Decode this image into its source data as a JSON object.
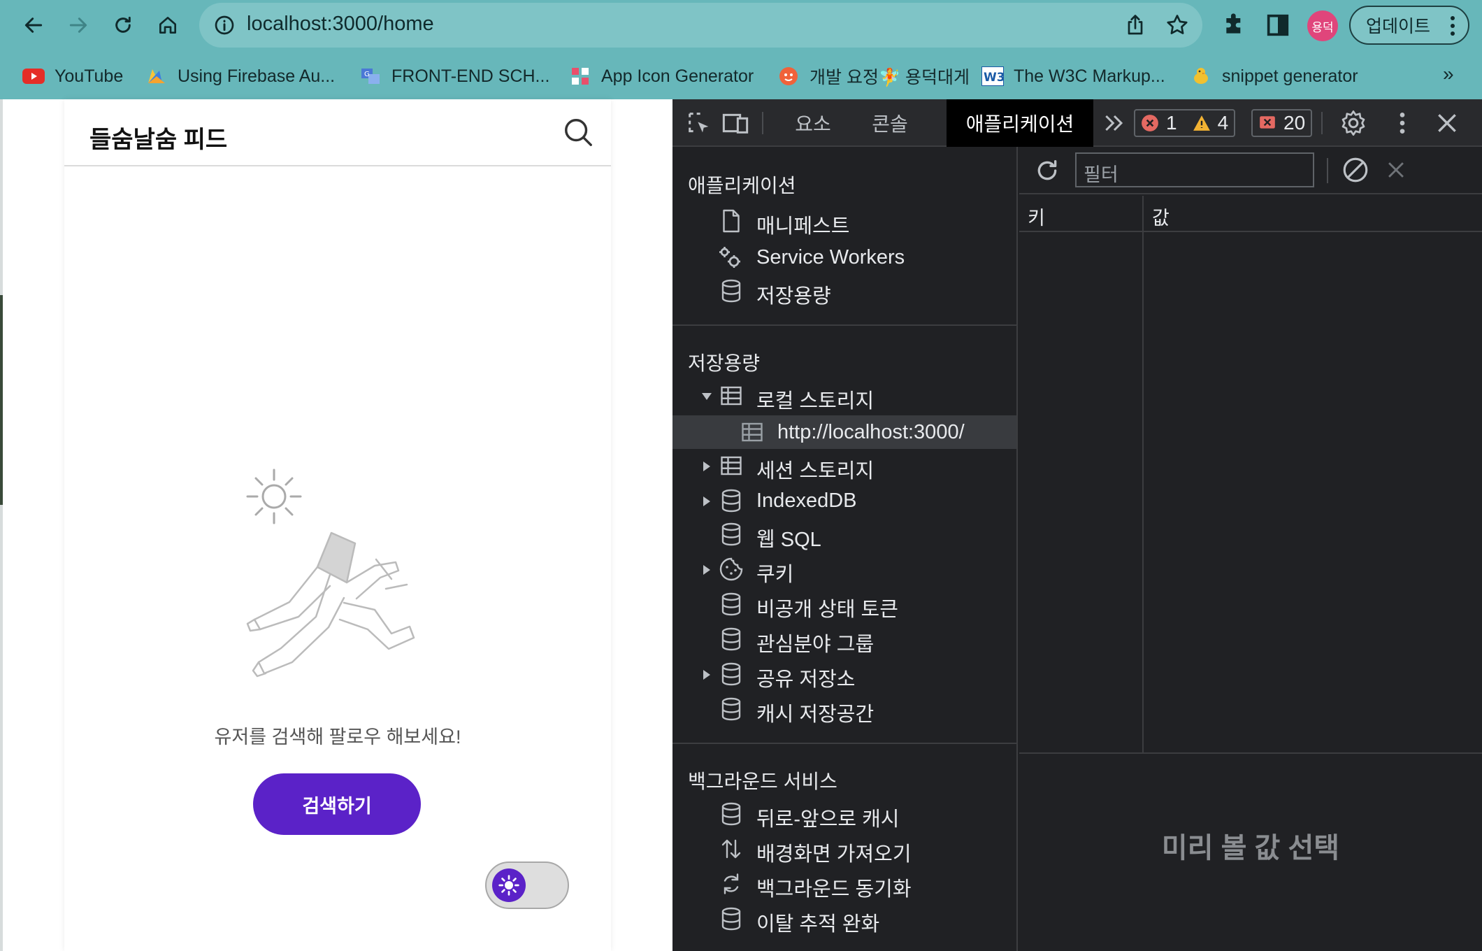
{
  "browser": {
    "url": "localhost:3000/home",
    "avatar_label": "용덕",
    "update_label": "업데이트",
    "bookmarks": [
      {
        "label": "YouTube",
        "icon": "youtube-icon"
      },
      {
        "label": "Using Firebase Au...",
        "icon": "firebase-icon"
      },
      {
        "label": "FRONT-END SCH...",
        "icon": "translate-icon"
      },
      {
        "label": "App Icon Generator",
        "icon": "grid-app-icon"
      },
      {
        "label": "개발 요정🧚 용덕대게",
        "icon": "dev-fairy-icon"
      },
      {
        "label": "The W3C Markup...",
        "icon": "w3c-icon"
      },
      {
        "label": "snippet generator",
        "icon": "snippet-icon"
      }
    ],
    "more_bookmarks": "»",
    "colors": {
      "chrome": "#67b7ba",
      "omnibox": "#7fc4c6"
    }
  },
  "page": {
    "title": "들숨날숨 피드",
    "empty_message": "유저를 검색해 팔로우 해보세요!",
    "cta_label": "검색하기",
    "accent": "#5b22c8"
  },
  "devtools": {
    "tabs": [
      "요소",
      "콘솔",
      "애플리케이션"
    ],
    "active_tab": "애플리케이션",
    "errors": "1",
    "warnings": "4",
    "issues": "20",
    "sections": {
      "application": {
        "title": "애플리케이션",
        "items": [
          "매니페스트",
          "Service Workers",
          "저장용량"
        ]
      },
      "storage": {
        "title": "저장용량",
        "items": [
          "로컬 스토리지",
          "http://localhost:3000/",
          "세션 스토리지",
          "IndexedDB",
          "웹 SQL",
          "쿠키",
          "비공개 상태 토큰",
          "관심분야 그룹",
          "공유 저장소",
          "캐시 저장공간"
        ]
      },
      "background": {
        "title": "백그라운드 서비스",
        "items": [
          "뒤로-앞으로 캐시",
          "배경화면 가져오기",
          "백그라운드 동기화",
          "이탈 추적 완화"
        ]
      }
    },
    "filter_placeholder": "필터",
    "columns": {
      "key": "키",
      "value": "값"
    },
    "preview_empty": "미리 볼 값 선택"
  }
}
